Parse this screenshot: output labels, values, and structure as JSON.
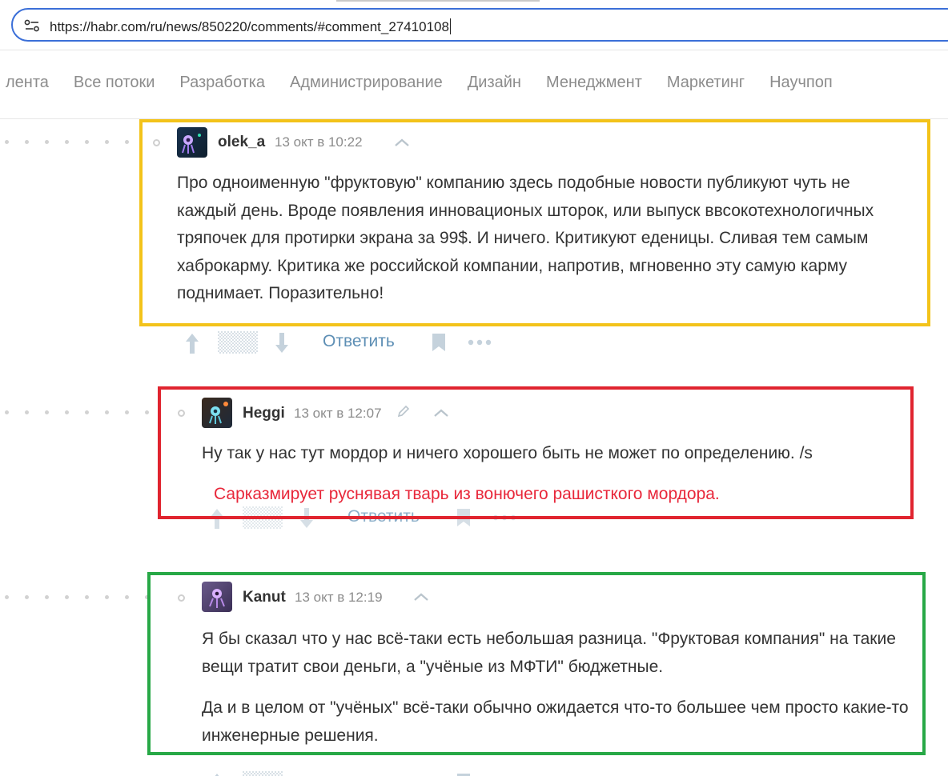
{
  "browser": {
    "url": "https://habr.com/ru/news/850220/comments/#comment_27410108"
  },
  "nav": {
    "items": [
      "лента",
      "Все потоки",
      "Разработка",
      "Администрирование",
      "Дизайн",
      "Менеджмент",
      "Маркетинг",
      "Научпоп"
    ]
  },
  "comments": [
    {
      "author": "olek_a",
      "time": "13 окт в 10:22",
      "body": [
        "Про одноименную \"фруктовую\" компанию здесь подобные новости публикуют чуть не каждый день. Вроде появления инновационых шторок, или выпуск ввсокотехнологичных тряпочек для протирки экрана за 99$. И ничего. Критикуют еденицы. Сливая тем самым хаброкарму. Критика же российской компании, напротив, мгновенно эту самую карму поднимает. Поразительно!"
      ],
      "reply_label": "Ответить",
      "highlight_color": "#f3c31a"
    },
    {
      "author": "Heggi",
      "time": "13 окт в 12:07",
      "body": [
        "Ну так у нас тут мордор и ничего хорошего быть не может по определению. /s"
      ],
      "reply_label": "Ответить",
      "annotation": "Сарказмирует руснявая тварь из вонючего рашисткого мордора.",
      "highlight_color": "#e0242f"
    },
    {
      "author": "Kanut",
      "time": "13 окт в 12:19",
      "body": [
        "Я бы сказал что у нас всё-таки есть небольшая разница. \"Фруктовая компания\" на такие вещи тратит свои деньги, а \"учёные из МФТИ\" бюджетные.",
        "Да и в целом от \"учёных\" всё-таки обычно ожидается что-то большее чем просто какие-то инженерные решения."
      ],
      "highlight_color": "#27a846"
    }
  ],
  "icons": {
    "site_settings": "site-settings-icon",
    "collapse": "chevron-up-icon",
    "upvote": "arrow-up-icon",
    "downvote": "arrow-down-icon",
    "bookmark": "bookmark-icon",
    "more": "more-icon",
    "edited": "pencil-icon"
  }
}
